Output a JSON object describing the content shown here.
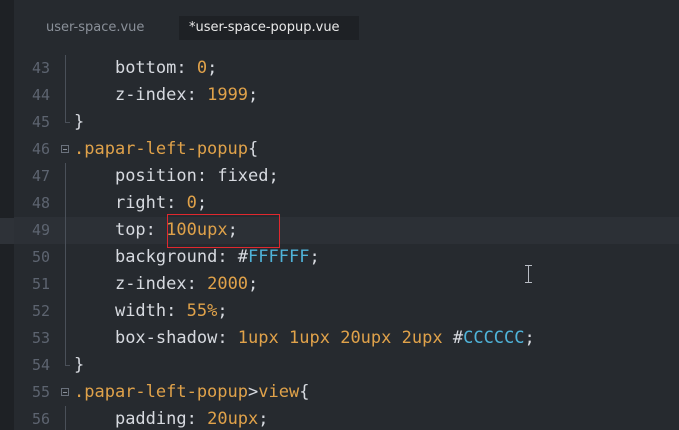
{
  "tabs": {
    "inactive_label": "user-space.vue",
    "active_label": "*user-space-popup.vue"
  },
  "lines": [
    {
      "num": "43",
      "indent": "    ",
      "parts": [
        {
          "t": "prop",
          "v": "bottom"
        },
        {
          "t": "punc",
          "v": ": "
        },
        {
          "t": "num",
          "v": "0"
        },
        {
          "t": "punc",
          "v": ";"
        }
      ]
    },
    {
      "num": "44",
      "indent": "    ",
      "parts": [
        {
          "t": "prop",
          "v": "z-index"
        },
        {
          "t": "punc",
          "v": ": "
        },
        {
          "t": "num",
          "v": "1999"
        },
        {
          "t": "punc",
          "v": ";"
        }
      ]
    },
    {
      "num": "45",
      "indent": "",
      "parts": [
        {
          "t": "punc",
          "v": "}"
        }
      ]
    },
    {
      "num": "46",
      "indent": "",
      "parts": [
        {
          "t": "sel",
          "v": ".papar-left-popup"
        },
        {
          "t": "punc",
          "v": "{"
        }
      ]
    },
    {
      "num": "47",
      "indent": "    ",
      "parts": [
        {
          "t": "prop",
          "v": "position"
        },
        {
          "t": "punc",
          "v": ": "
        },
        {
          "t": "kw",
          "v": "fixed"
        },
        {
          "t": "punc",
          "v": ";"
        }
      ]
    },
    {
      "num": "48",
      "indent": "    ",
      "parts": [
        {
          "t": "prop",
          "v": "right"
        },
        {
          "t": "punc",
          "v": ": "
        },
        {
          "t": "num",
          "v": "0"
        },
        {
          "t": "punc",
          "v": ";"
        }
      ]
    },
    {
      "num": "49",
      "indent": "    ",
      "parts": [
        {
          "t": "prop",
          "v": "top"
        },
        {
          "t": "punc",
          "v": ": "
        },
        {
          "t": "num",
          "v": "100upx"
        },
        {
          "t": "punc",
          "v": ";"
        }
      ]
    },
    {
      "num": "50",
      "indent": "    ",
      "parts": [
        {
          "t": "prop",
          "v": "background"
        },
        {
          "t": "punc",
          "v": ": "
        },
        {
          "t": "hash",
          "v": "#"
        },
        {
          "t": "hex",
          "v": "FFFFFF"
        },
        {
          "t": "punc",
          "v": ";"
        }
      ]
    },
    {
      "num": "51",
      "indent": "    ",
      "parts": [
        {
          "t": "prop",
          "v": "z-index"
        },
        {
          "t": "punc",
          "v": ": "
        },
        {
          "t": "num",
          "v": "2000"
        },
        {
          "t": "punc",
          "v": ";"
        }
      ]
    },
    {
      "num": "52",
      "indent": "    ",
      "parts": [
        {
          "t": "prop",
          "v": "width"
        },
        {
          "t": "punc",
          "v": ": "
        },
        {
          "t": "num",
          "v": "55%"
        },
        {
          "t": "punc",
          "v": ";"
        }
      ]
    },
    {
      "num": "53",
      "indent": "    ",
      "parts": [
        {
          "t": "prop",
          "v": "box-shadow"
        },
        {
          "t": "punc",
          "v": ": "
        },
        {
          "t": "num",
          "v": "1upx"
        },
        {
          "t": "punc",
          "v": " "
        },
        {
          "t": "num",
          "v": "1upx"
        },
        {
          "t": "punc",
          "v": " "
        },
        {
          "t": "num",
          "v": "20upx"
        },
        {
          "t": "punc",
          "v": " "
        },
        {
          "t": "num",
          "v": "2upx"
        },
        {
          "t": "punc",
          "v": " "
        },
        {
          "t": "hash",
          "v": "#"
        },
        {
          "t": "hex",
          "v": "CCCCCC"
        },
        {
          "t": "punc",
          "v": ";"
        }
      ]
    },
    {
      "num": "54",
      "indent": "",
      "parts": [
        {
          "t": "punc",
          "v": "}"
        }
      ]
    },
    {
      "num": "55",
      "indent": "",
      "parts": [
        {
          "t": "sel",
          "v": ".papar-left-popup"
        },
        {
          "t": "punc",
          "v": ">"
        },
        {
          "t": "sel",
          "v": "view"
        },
        {
          "t": "punc",
          "v": "{"
        }
      ]
    },
    {
      "num": "56",
      "indent": "    ",
      "parts": [
        {
          "t": "prop",
          "v": "padding"
        },
        {
          "t": "punc",
          "v": ": "
        },
        {
          "t": "num",
          "v": "20upx"
        },
        {
          "t": "punc",
          "v": ";"
        }
      ]
    }
  ],
  "current_line": "49",
  "fold_lines": [
    "46",
    "55"
  ],
  "guide_lines": [
    "43",
    "44",
    "47",
    "48",
    "49",
    "50",
    "51",
    "52",
    "53",
    "56"
  ],
  "guide_end_lines": [
    "45",
    "54"
  ],
  "colors": {
    "background": "#262a2f",
    "number": "#e0a24a",
    "selector": "#e0a24a",
    "hex_value": "#4fb3d9",
    "text": "#d7dae0",
    "line_number": "#5d6470",
    "annotation_box": "#e0282e"
  },
  "icons": {
    "fold": "fold-toggle-icon",
    "cursor": "text-cursor-icon"
  }
}
